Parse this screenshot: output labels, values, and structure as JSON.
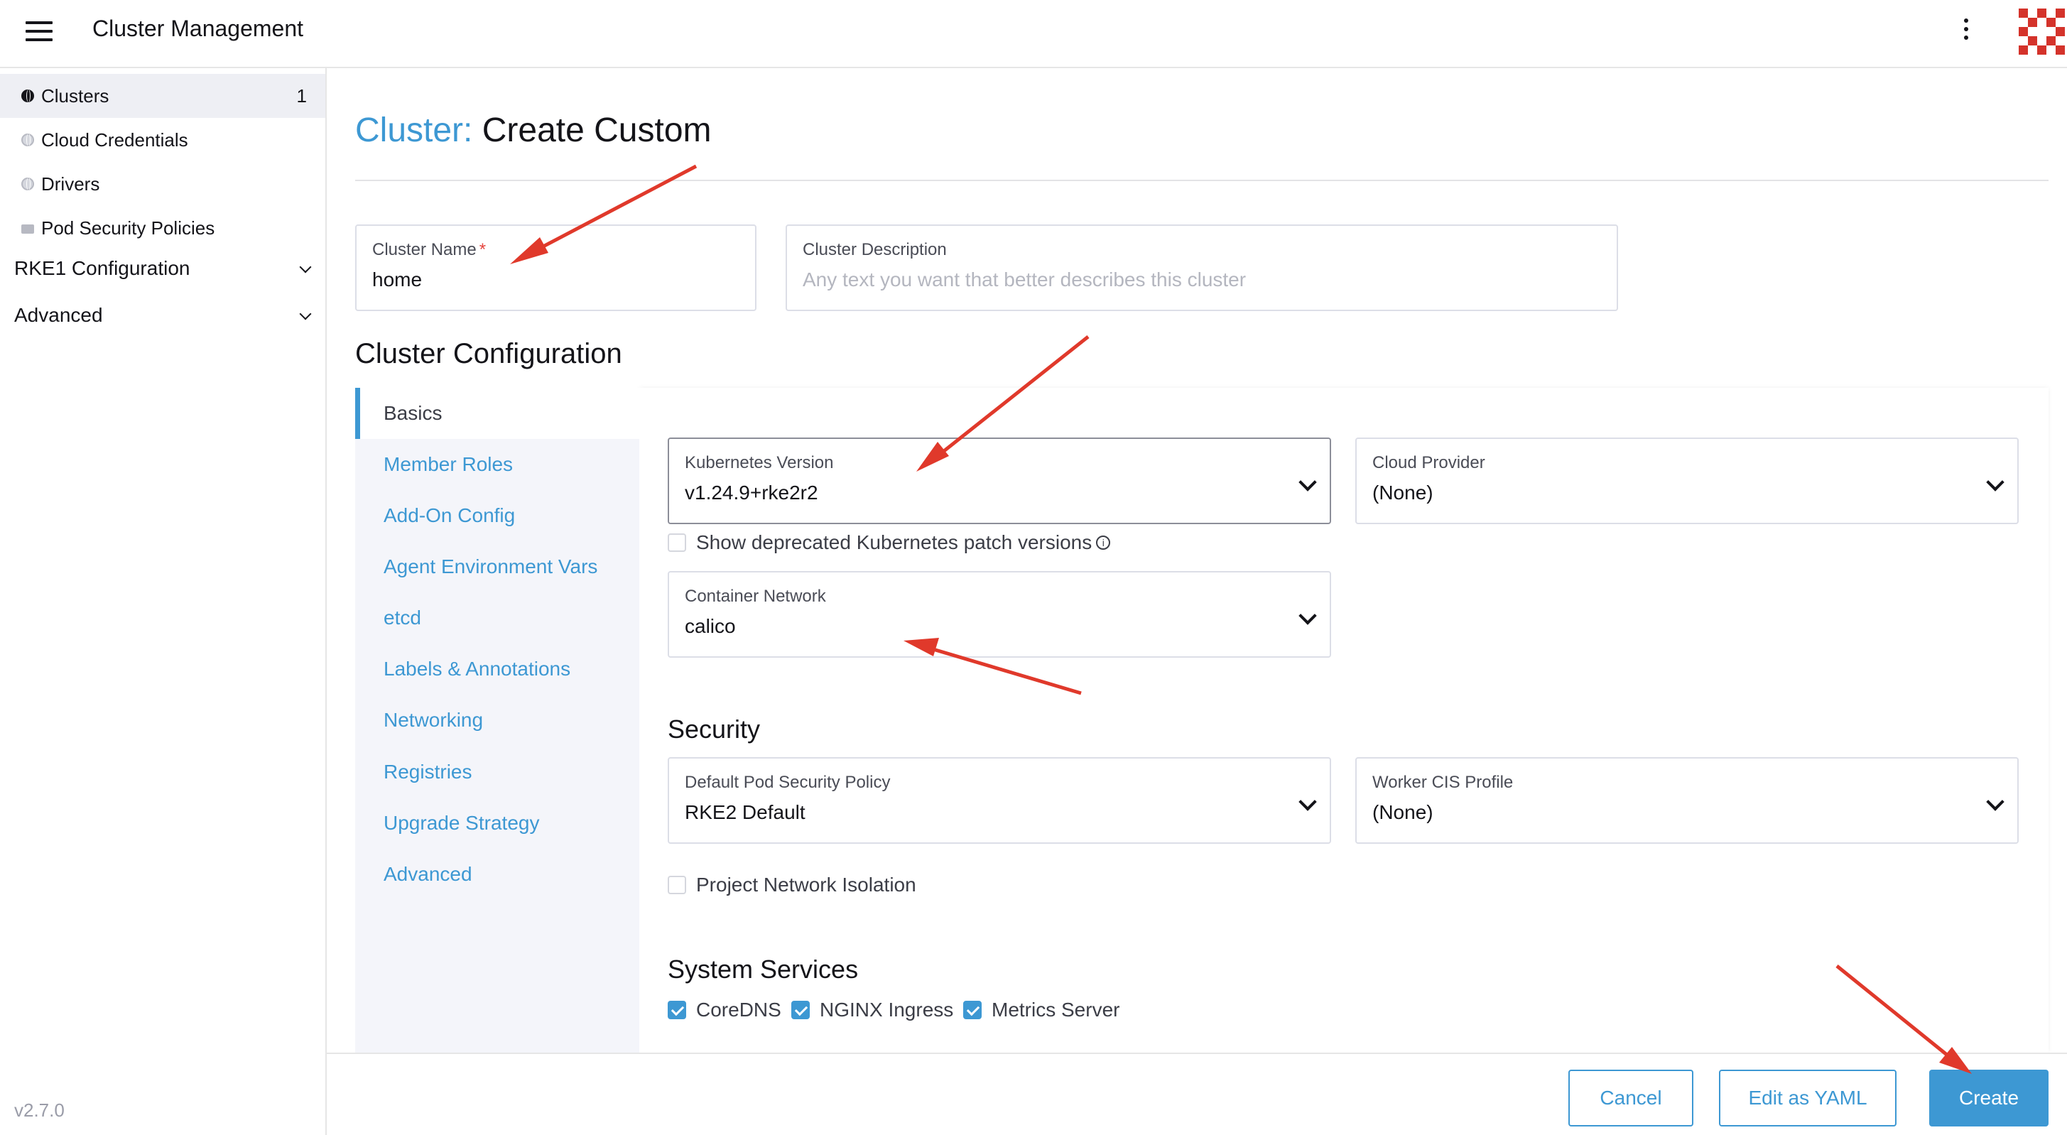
{
  "header": {
    "title": "Cluster Management"
  },
  "sidebar": {
    "items": [
      {
        "label": "Clusters",
        "count": "1"
      },
      {
        "label": "Cloud Credentials"
      },
      {
        "label": "Drivers"
      },
      {
        "label": "Pod Security Policies"
      }
    ],
    "groups": [
      {
        "label": "RKE1 Configuration"
      },
      {
        "label": "Advanced"
      }
    ],
    "version": "v2.7.0"
  },
  "page": {
    "title_prefix": "Cluster:",
    "title_main": "Create Custom"
  },
  "cluster_name": {
    "label": "Cluster Name",
    "required_mark": "*",
    "value": "home"
  },
  "cluster_description": {
    "label": "Cluster Description",
    "placeholder": "Any text you want that better describes this cluster"
  },
  "config": {
    "heading": "Cluster Configuration",
    "nav": [
      "Basics",
      "Member Roles",
      "Add-On Config",
      "Agent Environment Vars",
      "etcd",
      "Labels & Annotations",
      "Networking",
      "Registries",
      "Upgrade Strategy",
      "Advanced"
    ],
    "kubernetes_version": {
      "label": "Kubernetes Version",
      "value": "v1.24.9+rke2r2"
    },
    "cloud_provider": {
      "label": "Cloud Provider",
      "value": "(None)"
    },
    "show_deprecated": {
      "label": "Show deprecated Kubernetes patch versions",
      "checked": false,
      "info_icon": "i"
    },
    "container_network": {
      "label": "Container Network",
      "value": "calico"
    },
    "security": {
      "heading": "Security",
      "psp": {
        "label": "Default Pod Security Policy",
        "value": "RKE2 Default"
      },
      "cis": {
        "label": "Worker CIS Profile",
        "value": "(None)"
      },
      "network_isolation": {
        "label": "Project Network Isolation",
        "checked": false
      }
    },
    "system_services": {
      "heading": "System Services",
      "items": [
        {
          "label": "CoreDNS",
          "checked": true
        },
        {
          "label": "NGINX Ingress",
          "checked": true
        },
        {
          "label": "Metrics Server",
          "checked": true
        }
      ]
    }
  },
  "footer": {
    "cancel": "Cancel",
    "edit_yaml": "Edit as YAML",
    "create": "Create"
  },
  "colors": {
    "accent": "#3d98d3",
    "annotation_arrow": "#e0392b",
    "logo": "#d4332b"
  }
}
